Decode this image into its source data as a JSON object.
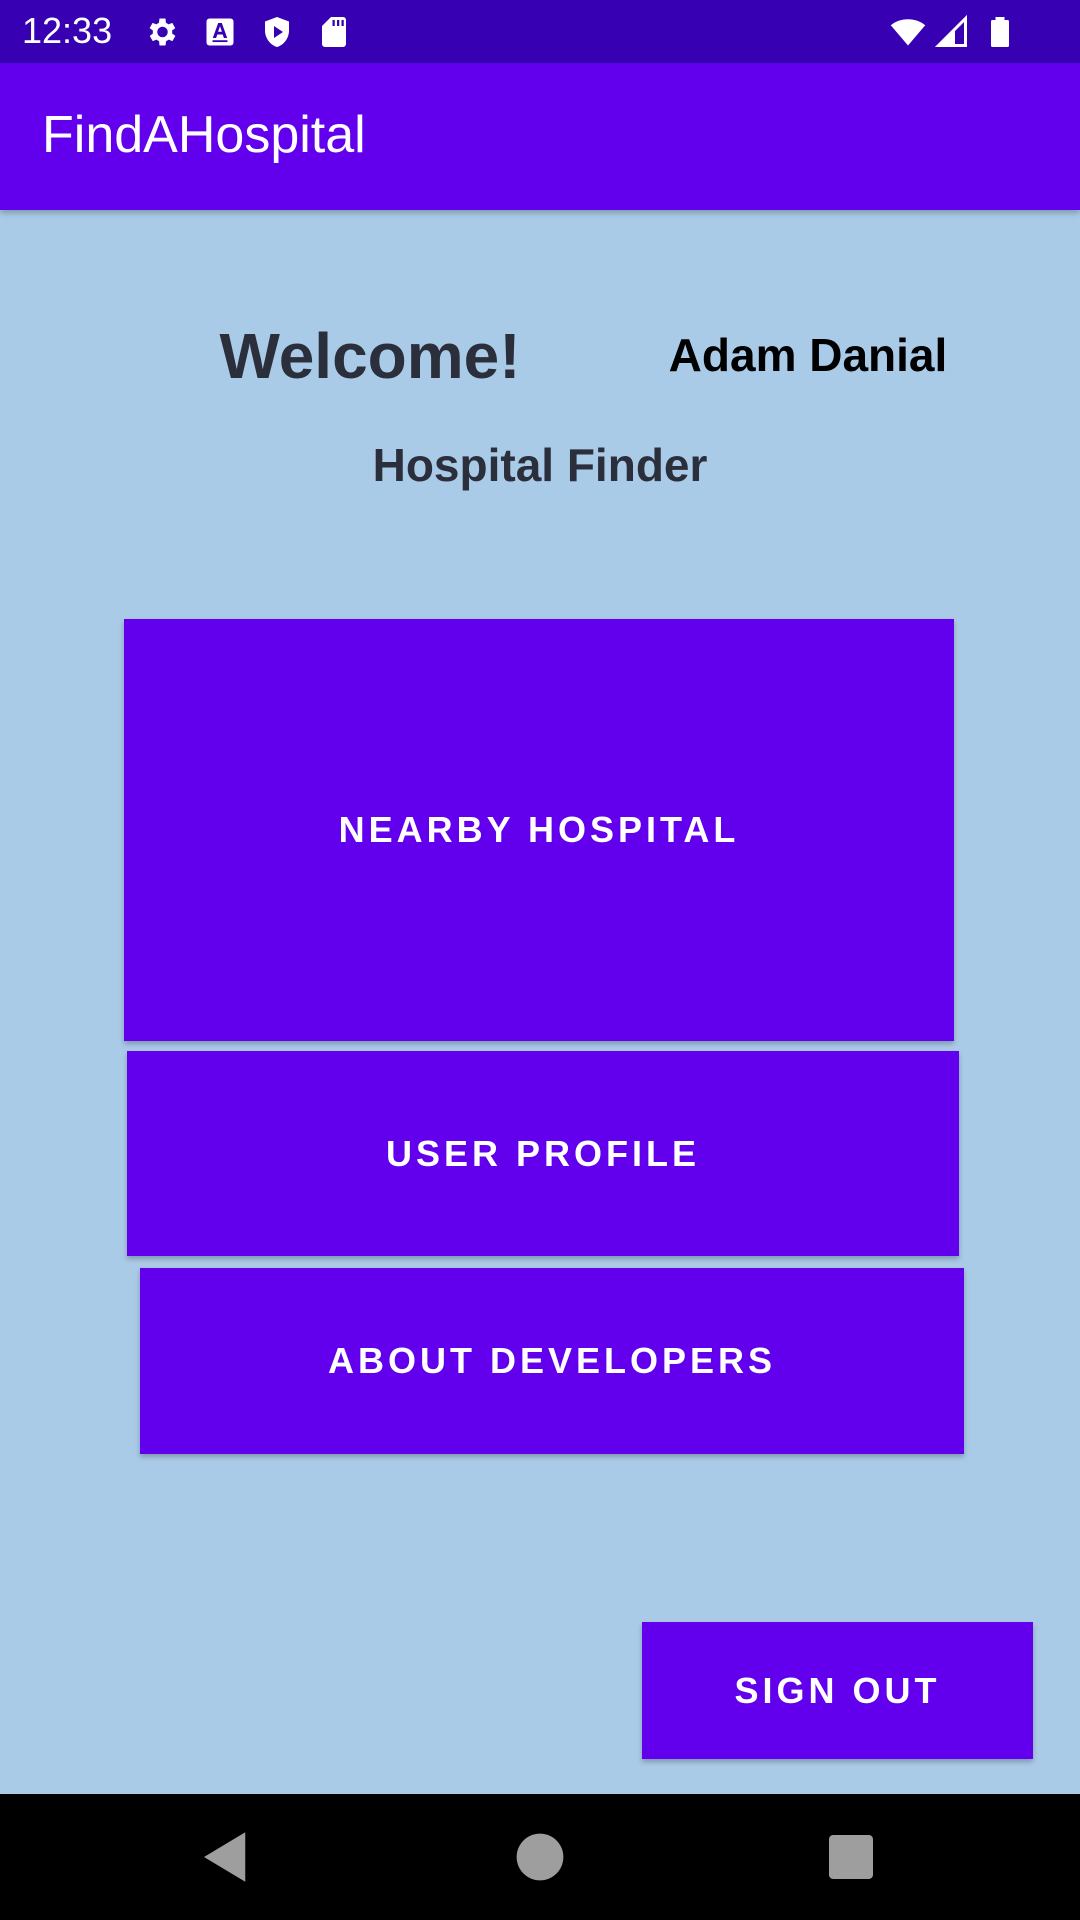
{
  "status_bar": {
    "time": "12:33",
    "left_icons": [
      "settings-icon",
      "font-a-icon",
      "play-protect-icon",
      "sd-card-icon"
    ],
    "right_icons": [
      "wifi-icon",
      "cell-signal-icon",
      "battery-icon"
    ]
  },
  "app_bar": {
    "title": "FindAHospital"
  },
  "main": {
    "welcome": "Welcome!",
    "user_name": "Adam Danial",
    "subtitle": "Hospital Finder",
    "buttons": {
      "nearby_hospital": "NEARBY HOSPITAL",
      "user_profile": "USER PROFILE",
      "about_developers": "ABOUT DEVELOPERS",
      "sign_out": "SIGN OUT"
    }
  },
  "nav_bar": {
    "icons": [
      "back-icon",
      "home-icon",
      "recents-icon"
    ]
  },
  "colors": {
    "status_bar": "#3700b3",
    "primary": "#6200ee",
    "background": "#aacbe8",
    "text_dark": "#2b2f3b"
  }
}
